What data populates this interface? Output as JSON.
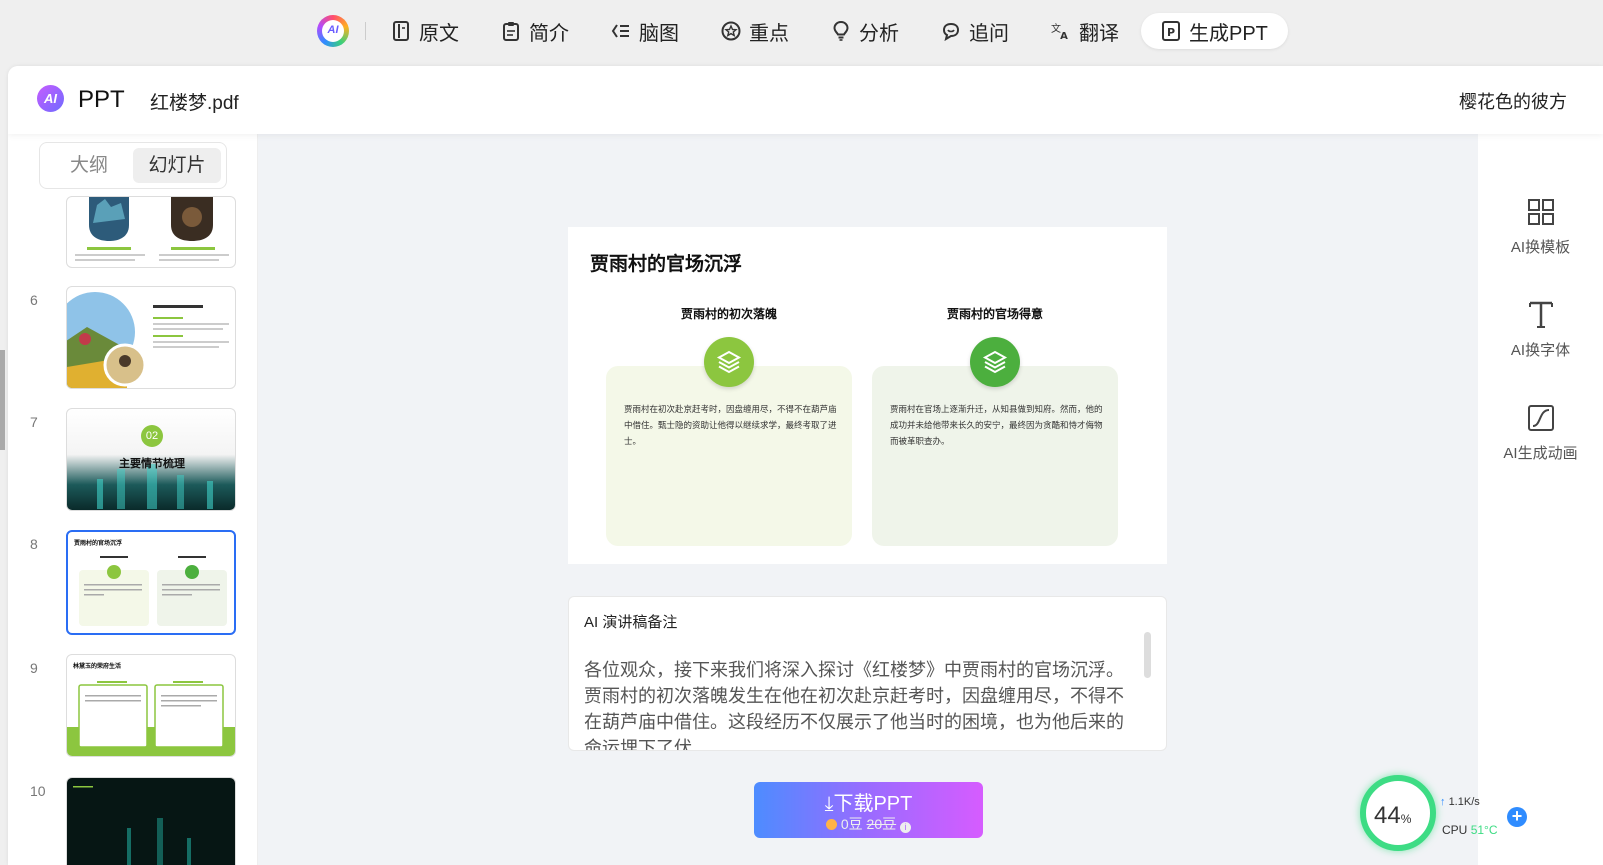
{
  "toolbar": {
    "logo_text": "AI",
    "items": [
      {
        "label": "原文",
        "icon": "document-icon"
      },
      {
        "label": "简介",
        "icon": "clipboard-icon"
      },
      {
        "label": "脑图",
        "icon": "mindmap-icon"
      },
      {
        "label": "重点",
        "icon": "star-icon"
      },
      {
        "label": "分析",
        "icon": "lightbulb-icon"
      },
      {
        "label": "追问",
        "icon": "chat-icon"
      },
      {
        "label": "翻译",
        "icon": "translate-icon"
      },
      {
        "label": "生成PPT",
        "icon": "ppt-icon",
        "active": true
      }
    ]
  },
  "header": {
    "brand_badge": "AI",
    "brand_name": "PPT",
    "file_name": "红楼梦.pdf",
    "user_name": "樱花色的彼方"
  },
  "sidebar": {
    "tabs": [
      "大纲",
      "幻灯片"
    ],
    "active_tab": "幻灯片",
    "thumbnails": [
      {
        "num": "",
        "label": ""
      },
      {
        "num": "6",
        "title": "林黛玉的生活经历"
      },
      {
        "num": "7",
        "badge": "02",
        "title": "主要情节梳理"
      },
      {
        "num": "8",
        "title": "贾雨村的官场沉浮",
        "selected": true
      },
      {
        "num": "9",
        "title": "林黛玉的荣府生活"
      },
      {
        "num": "10",
        "title": ""
      }
    ]
  },
  "slide": {
    "title": "贾雨村的官场沉浮",
    "columns": [
      {
        "title": "贾雨村的初次落魄",
        "text": "贾雨村在初次赴京赶考时，因盘缠用尽，不得不在葫芦庙中借住。甄士隐的资助让他得以继续求学，最终考取了进士。",
        "icon_color": "#8cc63f",
        "card_color": "#f4f8e8"
      },
      {
        "title": "贾雨村的官场得意",
        "text": "贾雨村在官场上逐渐升迁，从知县做到知府。然而，他的成功并未给他带来长久的安宁，最终因为贪酷和恃才侮物而被革职查办。",
        "icon_color": "#4caf3e",
        "card_color": "#eff4ea"
      }
    ]
  },
  "notes": {
    "title": "AI 演讲稿备注",
    "text": "各位观众，接下来我们将深入探讨《红楼梦》中贾雨村的官场沉浮。贾雨村的初次落魄发生在他在初次赴京赶考时，因盘缠用尽，不得不在葫芦庙中借住。这段经历不仅展示了他当时的困境，也为他后来的命运埋下了伏"
  },
  "download": {
    "label": "下载PPT",
    "price_now": "0豆",
    "price_old": "20豆"
  },
  "right_panel": {
    "items": [
      {
        "label": "AI换模板",
        "icon": "grid-icon"
      },
      {
        "label": "AI换字体",
        "icon": "text-icon"
      },
      {
        "label": "AI生成动画",
        "icon": "animation-icon"
      }
    ]
  },
  "monitor": {
    "percent": "44",
    "percent_unit": "%",
    "net_speed": "1.1K/s",
    "cpu_label": "CPU",
    "cpu_temp": "51°C",
    "plus": "+"
  },
  "colors": {
    "accent": "#2a6df4",
    "green_light": "#8cc63f",
    "green_dark": "#4caf3e",
    "monitor_ring": "#3ddc84"
  }
}
